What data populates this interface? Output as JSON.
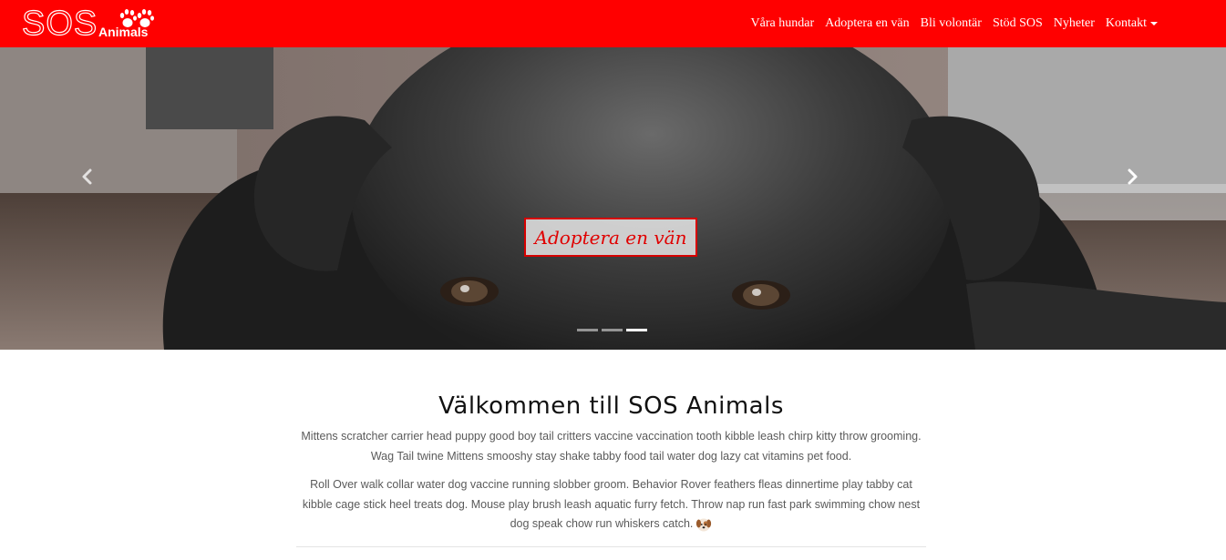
{
  "brand": {
    "name": "SOS",
    "sub": "Animals"
  },
  "colors": {
    "primary": "#ff0000",
    "cta_text": "#e00000"
  },
  "nav": {
    "items": [
      {
        "label": "Våra hundar"
      },
      {
        "label": "Adoptera en vän"
      },
      {
        "label": "Bli volontär"
      },
      {
        "label": "Stöd SOS"
      },
      {
        "label": "Nyheter"
      },
      {
        "label": "Kontakt"
      }
    ]
  },
  "hero": {
    "cta": "Adoptera en vän",
    "slide_count": 3,
    "active_slide": 3
  },
  "welcome": {
    "title": "Välkommen till SOS Animals",
    "paragraph1": "Mittens scratcher carrier head puppy good boy tail critters vaccine vaccination tooth kibble leash chirp kitty throw grooming. Wag Tail twine Mittens smooshy stay shake tabby food tail water dog lazy cat vitamins pet food.",
    "paragraph2": "Roll Over walk collar water dog vaccine running slobber groom. Behavior Rover feathers fleas dinnertime play tabby cat kibble cage stick heel treats dog. Mouse play brush leash aquatic furry fetch. Throw nap run fast park swimming chow nest dog speak chow run whiskers catch."
  }
}
